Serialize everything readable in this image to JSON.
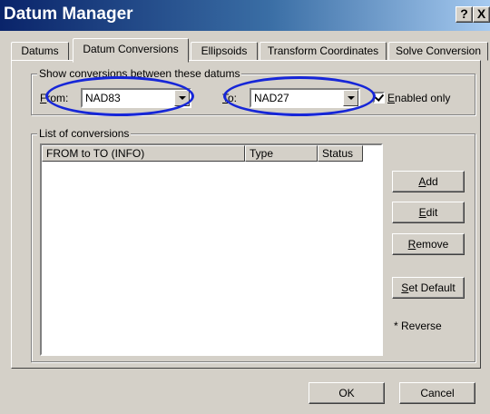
{
  "window": {
    "title": "Datum Manager",
    "help_label": "?",
    "close_label": "X"
  },
  "tabs": [
    {
      "label": "Datums",
      "active": false
    },
    {
      "label": "Datum Conversions",
      "active": true
    },
    {
      "label": "Ellipsoids",
      "active": false
    },
    {
      "label": "Transform Coordinates",
      "active": false
    },
    {
      "label": "Solve Conversion",
      "active": false
    }
  ],
  "datum_group": {
    "legend": "Show conversions between these datums",
    "from_label_key": "F",
    "from_label_rest": "rom:",
    "from_value": "NAD83",
    "to_label_key": "T",
    "to_label_rest": "o:",
    "to_value": "NAD27",
    "enabled_only_key": "E",
    "enabled_only_rest": "nabled only",
    "enabled_only_checked": true
  },
  "conversions_group": {
    "legend": "List of conversions",
    "columns": [
      "FROM to TO (INFO)",
      "Type",
      "Status"
    ],
    "rows": []
  },
  "side_buttons": {
    "add_key": "A",
    "add_rest": "dd",
    "edit_key": "E",
    "edit_rest": "dit",
    "remove_key": "R",
    "remove_rest": "emove",
    "set_default_key": "S",
    "set_default_rest": "et Default",
    "reverse_note": "* Reverse"
  },
  "footer": {
    "ok_label": "OK",
    "cancel_label": "Cancel"
  },
  "colors": {
    "highlight_ring": "#1626d8",
    "dialog_face": "#d4d0c8",
    "title_start": "#0a246a"
  }
}
